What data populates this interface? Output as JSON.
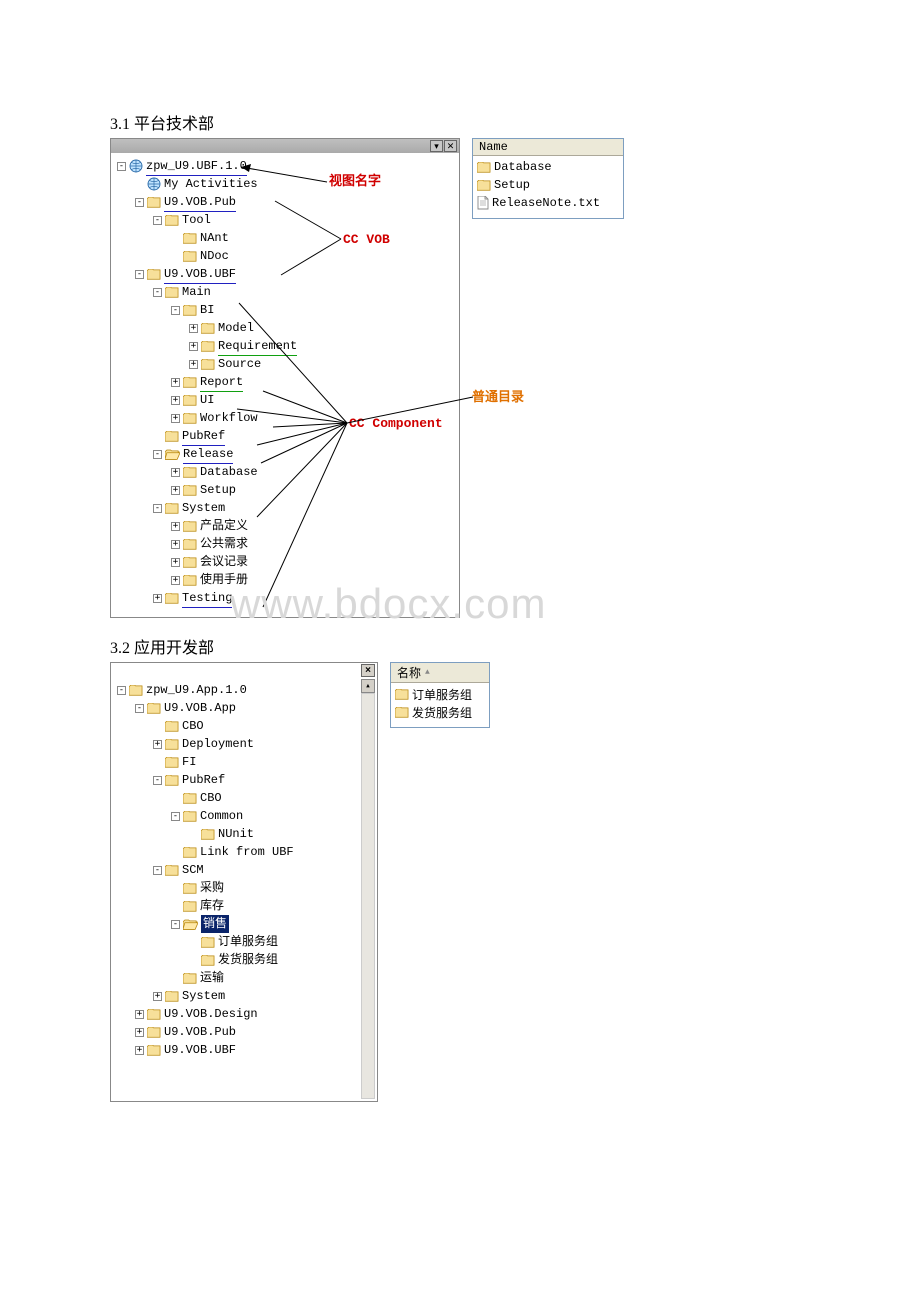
{
  "section1": {
    "title": "3.1 平台技术部"
  },
  "section2": {
    "title": "3.2 应用开发部"
  },
  "watermark": "www.bdocx.com",
  "annotations": {
    "view_name": "视图名字",
    "cc_vob": "CC VOB",
    "cc_component": "CC Component",
    "normal_dir": "普通目录"
  },
  "panel1": {
    "list_header": "Name",
    "list": [
      {
        "type": "folder",
        "label": "Database"
      },
      {
        "type": "folder",
        "label": "Setup"
      },
      {
        "type": "file",
        "label": "ReleaseNote.txt"
      }
    ],
    "tree": [
      {
        "d": 0,
        "exp": "-",
        "icon": "globe",
        "label": "zpw_U9.UBF.1.0",
        "ul": "blue"
      },
      {
        "d": 1,
        "exp": "",
        "icon": "globe",
        "label": "My Activities"
      },
      {
        "d": 1,
        "exp": "-",
        "icon": "folder",
        "label": "U9.VOB.Pub",
        "ul": "blue"
      },
      {
        "d": 2,
        "exp": "-",
        "icon": "folder",
        "label": "Tool"
      },
      {
        "d": 3,
        "exp": "",
        "icon": "folder",
        "label": "NAnt"
      },
      {
        "d": 3,
        "exp": "",
        "icon": "folder",
        "label": "NDoc"
      },
      {
        "d": 1,
        "exp": "-",
        "icon": "folder",
        "label": "U9.VOB.UBF",
        "ul": "blue"
      },
      {
        "d": 2,
        "exp": "-",
        "icon": "folder",
        "label": "Main"
      },
      {
        "d": 3,
        "exp": "-",
        "icon": "folder",
        "label": "BI"
      },
      {
        "d": 4,
        "exp": "+",
        "icon": "folder",
        "label": "Model"
      },
      {
        "d": 4,
        "exp": "+",
        "icon": "folder",
        "label": "Requirement",
        "ul": "green"
      },
      {
        "d": 4,
        "exp": "+",
        "icon": "folder",
        "label": "Source"
      },
      {
        "d": 3,
        "exp": "+",
        "icon": "folder",
        "label": "Report",
        "ul": "green"
      },
      {
        "d": 3,
        "exp": "+",
        "icon": "folder",
        "label": "UI"
      },
      {
        "d": 3,
        "exp": "+",
        "icon": "folder",
        "label": "Workflow"
      },
      {
        "d": 2,
        "exp": "",
        "icon": "folder",
        "label": "PubRef",
        "ul": "blue"
      },
      {
        "d": 2,
        "exp": "-",
        "icon": "folder-open",
        "label": "Release",
        "ul": "blue"
      },
      {
        "d": 3,
        "exp": "+",
        "icon": "folder",
        "label": "Database"
      },
      {
        "d": 3,
        "exp": "+",
        "icon": "folder",
        "label": "Setup"
      },
      {
        "d": 2,
        "exp": "-",
        "icon": "folder",
        "label": "System"
      },
      {
        "d": 3,
        "exp": "+",
        "icon": "folder",
        "label": "产品定义"
      },
      {
        "d": 3,
        "exp": "+",
        "icon": "folder",
        "label": "公共需求"
      },
      {
        "d": 3,
        "exp": "+",
        "icon": "folder",
        "label": "会议记录"
      },
      {
        "d": 3,
        "exp": "+",
        "icon": "folder",
        "label": "使用手册"
      },
      {
        "d": 2,
        "exp": "+",
        "icon": "folder",
        "label": "Testing",
        "ul": "blue"
      }
    ]
  },
  "panel2": {
    "list_header": "名称",
    "list": [
      {
        "type": "folder",
        "label": "订单服务组"
      },
      {
        "type": "folder",
        "label": "发货服务组"
      }
    ],
    "tree": [
      {
        "d": 0,
        "exp": "-",
        "icon": "folder",
        "label": "zpw_U9.App.1.0"
      },
      {
        "d": 1,
        "exp": "-",
        "icon": "folder",
        "label": "U9.VOB.App"
      },
      {
        "d": 2,
        "exp": "",
        "icon": "folder",
        "label": "CBO"
      },
      {
        "d": 2,
        "exp": "+",
        "icon": "folder",
        "label": "Deployment"
      },
      {
        "d": 2,
        "exp": "",
        "icon": "folder",
        "label": "FI"
      },
      {
        "d": 2,
        "exp": "-",
        "icon": "folder",
        "label": "PubRef"
      },
      {
        "d": 3,
        "exp": "",
        "icon": "folder",
        "label": "CBO"
      },
      {
        "d": 3,
        "exp": "-",
        "icon": "folder",
        "label": "Common"
      },
      {
        "d": 4,
        "exp": "",
        "icon": "folder",
        "label": "NUnit"
      },
      {
        "d": 3,
        "exp": "",
        "icon": "folder",
        "label": "Link from UBF"
      },
      {
        "d": 2,
        "exp": "-",
        "icon": "folder",
        "label": "SCM"
      },
      {
        "d": 3,
        "exp": "",
        "icon": "folder",
        "label": "采购"
      },
      {
        "d": 3,
        "exp": "",
        "icon": "folder",
        "label": "库存"
      },
      {
        "d": 3,
        "exp": "-",
        "icon": "folder-open",
        "label": "销售",
        "sel": true
      },
      {
        "d": 4,
        "exp": "",
        "icon": "folder",
        "label": "订单服务组"
      },
      {
        "d": 4,
        "exp": "",
        "icon": "folder",
        "label": "发货服务组"
      },
      {
        "d": 3,
        "exp": "",
        "icon": "folder",
        "label": "运输"
      },
      {
        "d": 2,
        "exp": "+",
        "icon": "folder",
        "label": "System"
      },
      {
        "d": 1,
        "exp": "+",
        "icon": "folder",
        "label": "U9.VOB.Design"
      },
      {
        "d": 1,
        "exp": "+",
        "icon": "folder",
        "label": "U9.VOB.Pub"
      },
      {
        "d": 1,
        "exp": "+",
        "icon": "folder",
        "label": "U9.VOB.UBF"
      }
    ]
  }
}
